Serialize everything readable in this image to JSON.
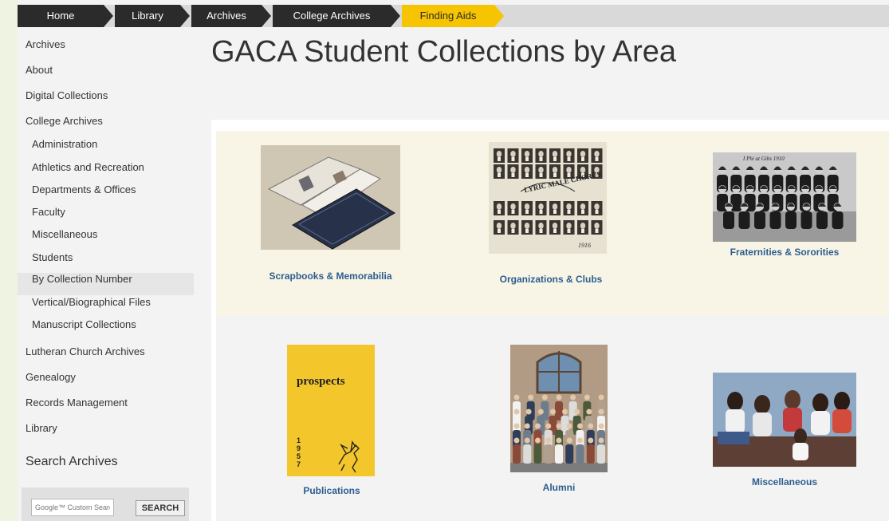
{
  "breadcrumb": [
    "Home",
    "Library",
    "Archives",
    "College Archives",
    "Finding Aids"
  ],
  "sidebar": {
    "items": [
      {
        "label": "Archives"
      },
      {
        "label": "About"
      },
      {
        "label": "Digital Collections"
      },
      {
        "label": "College Archives"
      },
      {
        "label": "Administration"
      },
      {
        "label": "Athletics and Recreation"
      },
      {
        "label": "Departments & Offices"
      },
      {
        "label": "Faculty"
      },
      {
        "label": "Miscellaneous"
      },
      {
        "label": "Students"
      },
      {
        "label": "By Collection Number"
      },
      {
        "label": "Vertical/Biographical Files"
      },
      {
        "label": "Manuscript Collections"
      },
      {
        "label": "Lutheran Church Archives"
      },
      {
        "label": "Genealogy"
      },
      {
        "label": "Records Management"
      },
      {
        "label": "Library"
      }
    ],
    "search_title": "Search Archives",
    "search_placeholder": "Google™ Custom Search",
    "search_button": "SEARCH"
  },
  "main": {
    "title": "GACA Student Collections by Area",
    "collections": [
      {
        "label": "Scrapbooks & Memorabilia"
      },
      {
        "label": "Organizations & Clubs"
      },
      {
        "label": "Fraternities & Sororities"
      },
      {
        "label": "Publications"
      },
      {
        "label": "Alumni"
      },
      {
        "label": "Miscellaneous"
      }
    ],
    "chorus_banner": "LYRIC MALE CHORUS",
    "chorus_year": "1916",
    "frat_caption": "I Phi at Gibs 1910",
    "publication_title": "prospects",
    "publication_year": "1957"
  }
}
